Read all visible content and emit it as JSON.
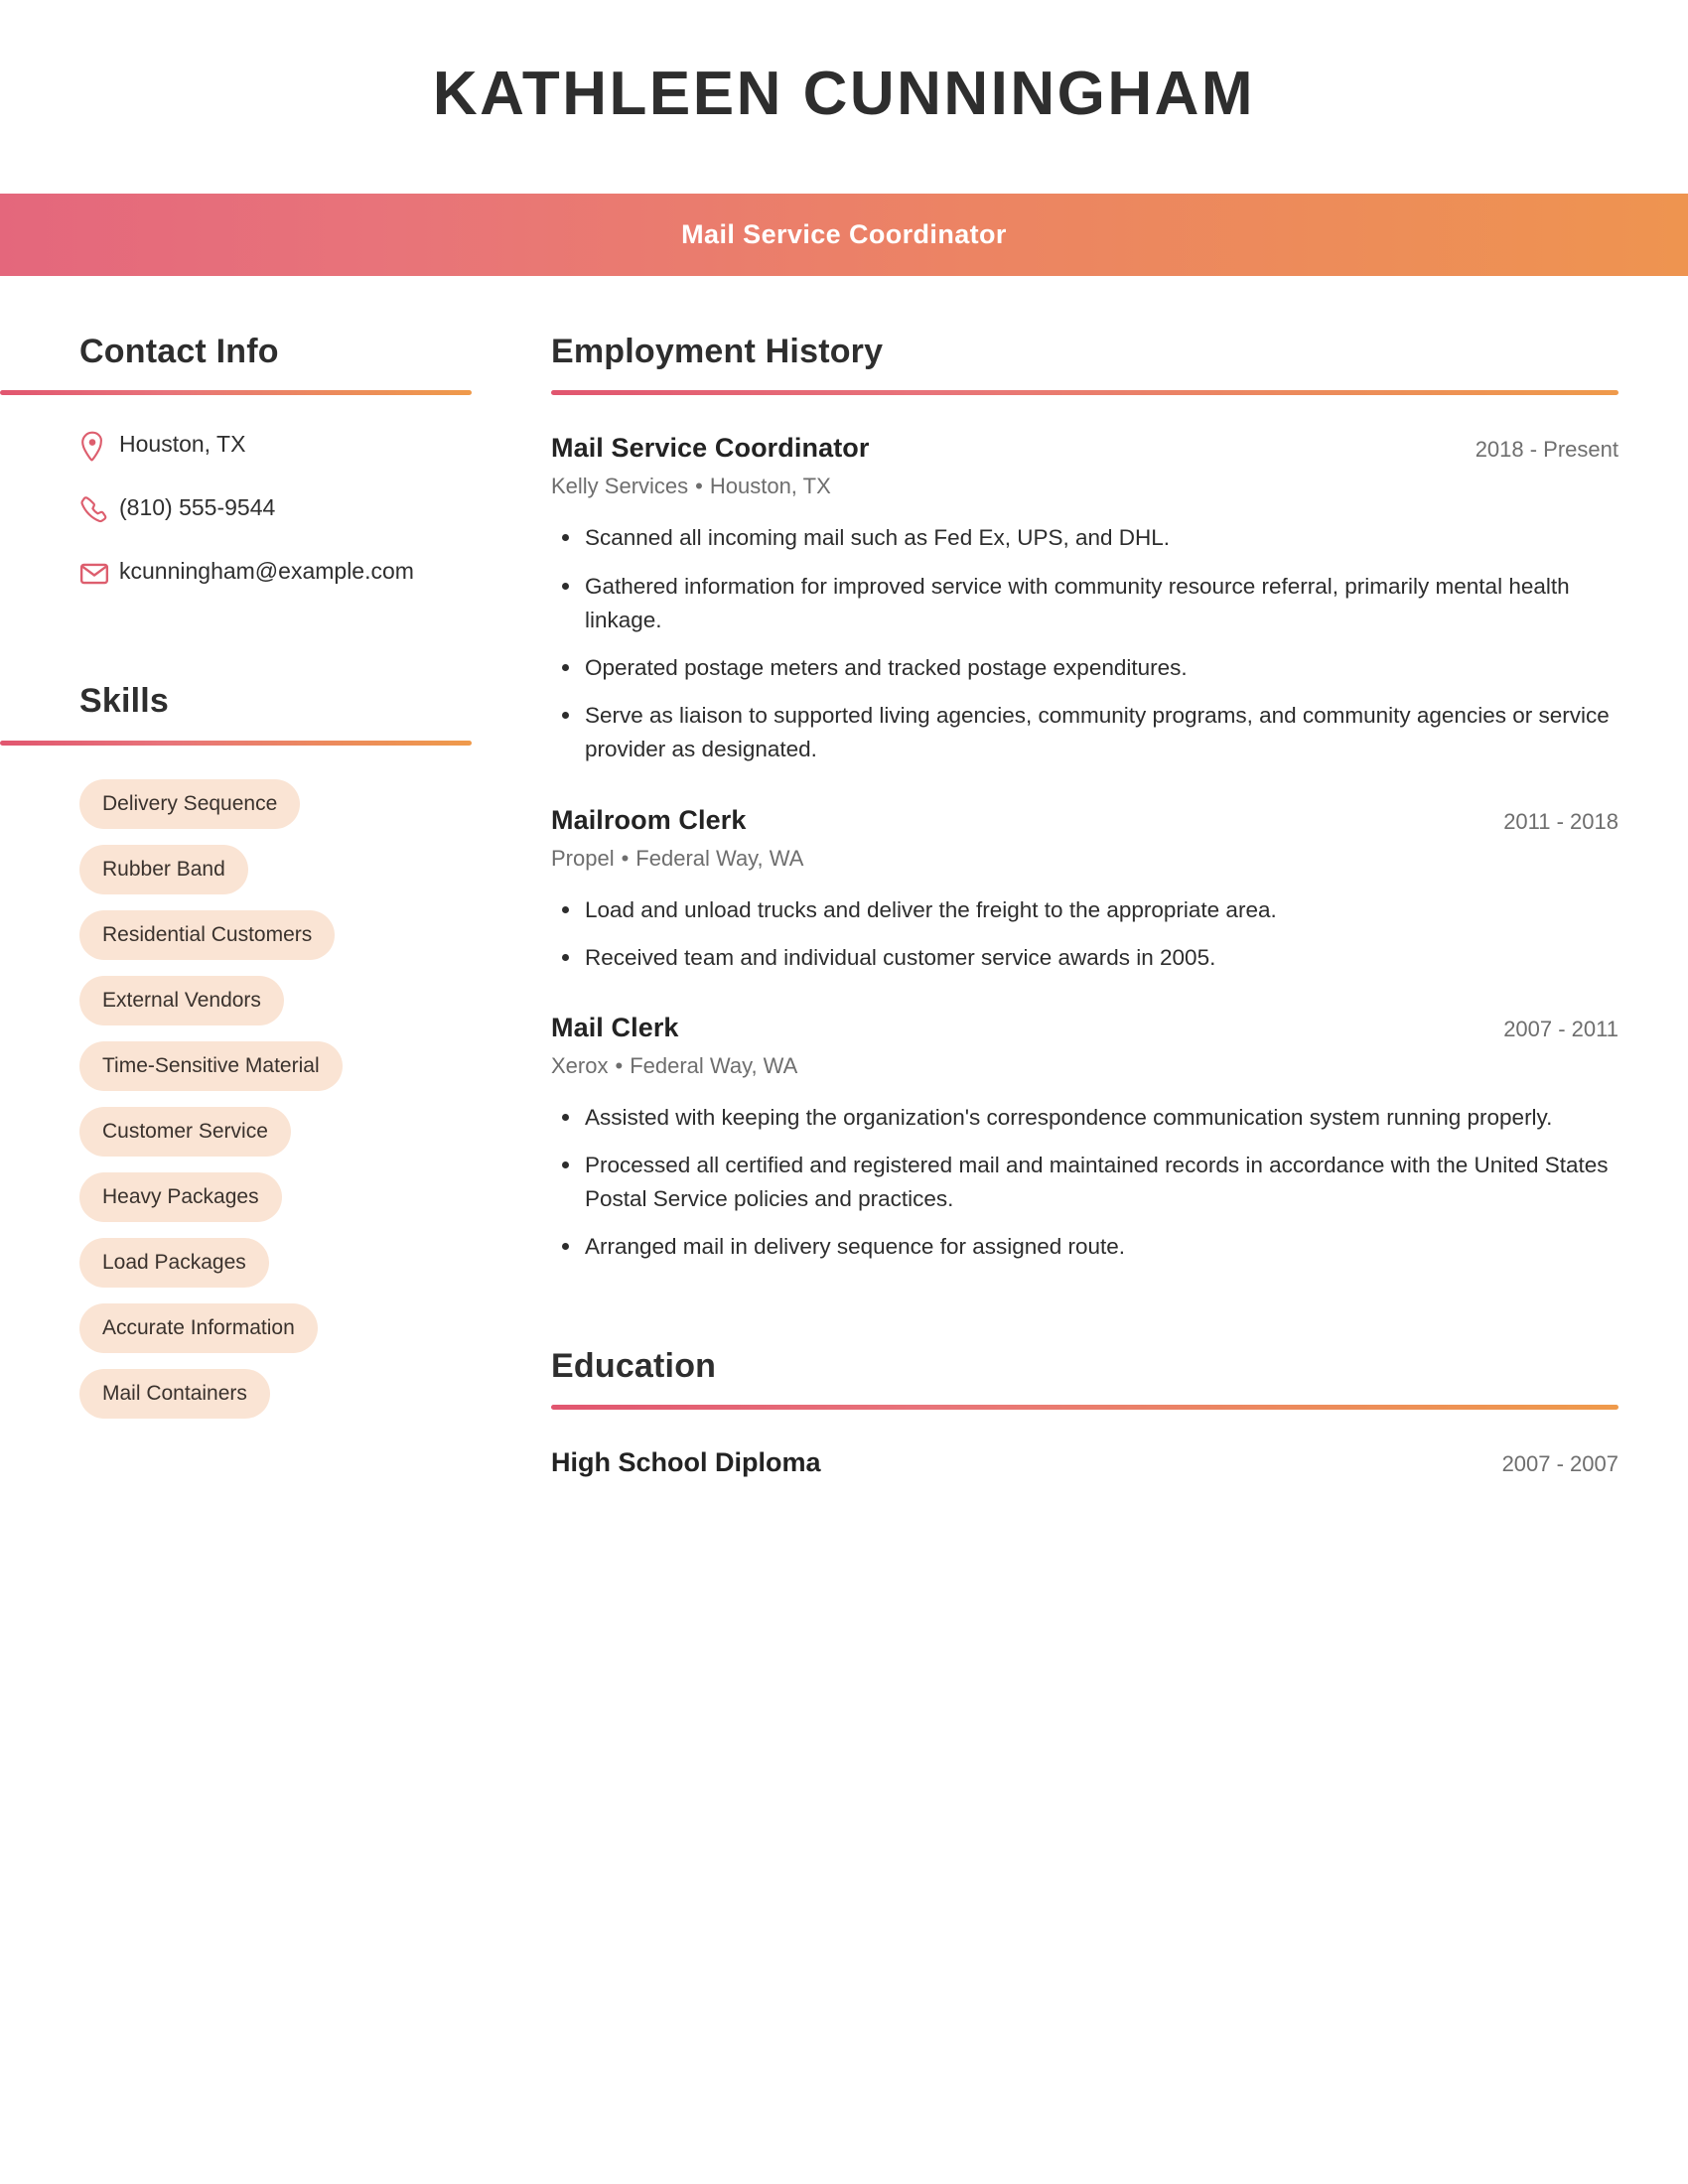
{
  "header": {
    "full_name": "KATHLEEN CUNNINGHAM",
    "job_title": "Mail Service Coordinator"
  },
  "theme": {
    "gradient_start": "#E4677C",
    "gradient_end": "#EE9450",
    "icon_color": "#DD5E6E",
    "pill_bg": "#FAE4D4",
    "text_dark": "#2E2E2E",
    "text_muted": "#6E6E6E"
  },
  "sidebar": {
    "contact": {
      "heading": "Contact Info",
      "items": [
        {
          "icon": "location-pin-icon",
          "value": "Houston, TX"
        },
        {
          "icon": "phone-icon",
          "value": "(810) 555-9544"
        },
        {
          "icon": "envelope-icon",
          "value": "kcunningham@example.com"
        }
      ]
    },
    "skills": {
      "heading": "Skills",
      "items": [
        "Delivery Sequence",
        "Rubber Band",
        "Residential Customers",
        "External Vendors",
        "Time-Sensitive Material",
        "Customer Service",
        "Heavy Packages",
        "Load Packages",
        "Accurate Information",
        "Mail Containers"
      ]
    }
  },
  "main": {
    "employment": {
      "heading": "Employment History",
      "jobs": [
        {
          "role": "Mail Service Coordinator",
          "dates": "2018 - Present",
          "company": "Kelly Services",
          "location": "Houston, TX",
          "separator": "•",
          "bullets": [
            "Scanned all incoming mail such as Fed Ex, UPS, and DHL.",
            "Gathered information for improved service with community resource referral, primarily mental health linkage.",
            "Operated postage meters and tracked postage expenditures.",
            "Serve as liaison to supported living agencies, community programs, and community agencies or service provider as designated."
          ]
        },
        {
          "role": "Mailroom Clerk",
          "dates": "2011 - 2018",
          "company": "Propel",
          "location": "Federal Way, WA",
          "separator": "•",
          "bullets": [
            "Load and unload trucks and deliver the freight to the appropriate area.",
            "Received team and individual customer service awards in 2005."
          ]
        },
        {
          "role": "Mail Clerk",
          "dates": "2007 - 2011",
          "company": "Xerox",
          "location": "Federal Way, WA",
          "separator": "•",
          "bullets": [
            "Assisted with keeping the organization's correspondence communication system running properly.",
            "Processed all certified and registered mail and maintained records in accordance with the United States Postal Service policies and practices.",
            "Arranged mail in delivery sequence for assigned route."
          ]
        }
      ]
    },
    "education": {
      "heading": "Education",
      "items": [
        {
          "degree": "High School Diploma",
          "dates": "2007 - 2007"
        }
      ]
    }
  }
}
